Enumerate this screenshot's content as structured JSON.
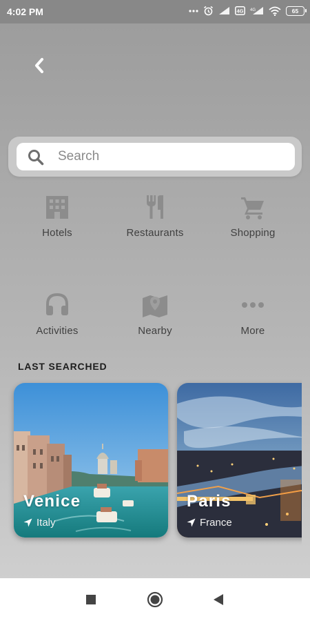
{
  "status_bar": {
    "time": "4:02 PM",
    "battery": "65"
  },
  "search": {
    "placeholder": "Search"
  },
  "categories": [
    {
      "label": "Hotels",
      "icon": "hotel-icon"
    },
    {
      "label": "Restaurants",
      "icon": "restaurant-icon"
    },
    {
      "label": "Shopping",
      "icon": "shopping-cart-icon"
    },
    {
      "label": "Activities",
      "icon": "headphones-icon"
    },
    {
      "label": "Nearby",
      "icon": "map-pin-icon"
    },
    {
      "label": "More",
      "icon": "more-dots-icon"
    }
  ],
  "last_searched": {
    "title": "LAST SEARCHED",
    "items": [
      {
        "city": "Venice",
        "country": "Italy"
      },
      {
        "city": "Paris",
        "country": "France"
      }
    ]
  },
  "colors": {
    "icon_gray": "#8c8c8c",
    "text_dark": "#404040",
    "accent_white": "#ffffff"
  }
}
